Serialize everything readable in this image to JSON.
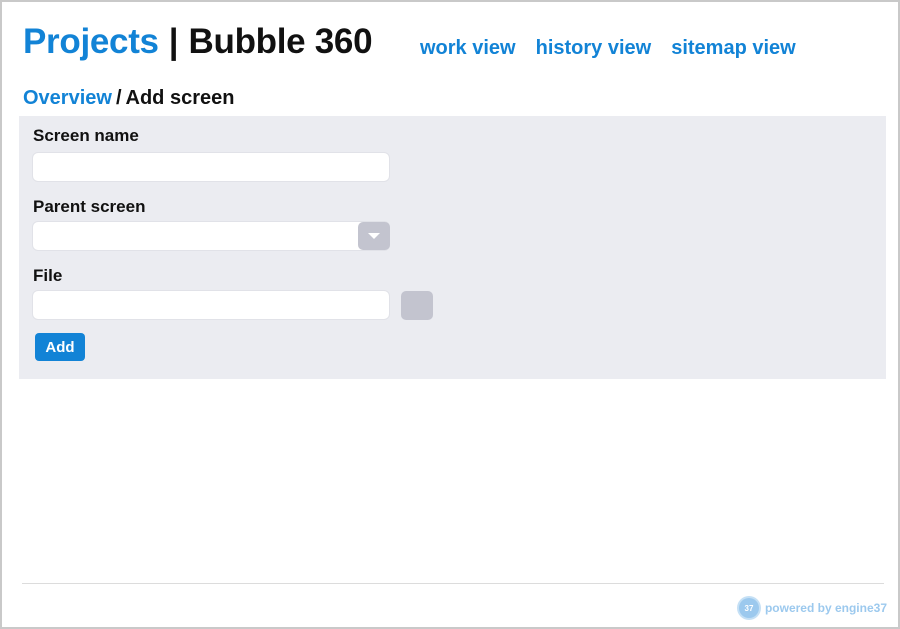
{
  "header": {
    "projects_link": "Projects",
    "separator": "|",
    "project_name": "Bubble 360"
  },
  "views": [
    {
      "label": "work view"
    },
    {
      "label": "history view"
    },
    {
      "label": "sitemap view"
    }
  ],
  "breadcrumb": {
    "overview": "Overview",
    "separator": "/",
    "current": "Add screen"
  },
  "form": {
    "screen_name_label": "Screen name",
    "screen_name_value": "",
    "parent_screen_label": "Parent screen",
    "parent_screen_value": "",
    "file_label": "File",
    "file_value": "",
    "add_button": "Add"
  },
  "footer": {
    "badge": "37",
    "powered_by": "powered by engine37"
  },
  "colors": {
    "accent": "#1283d6",
    "panel": "#ebecf1",
    "control_gray": "#c3c4cf",
    "footer_text": "#9cc9ee"
  }
}
